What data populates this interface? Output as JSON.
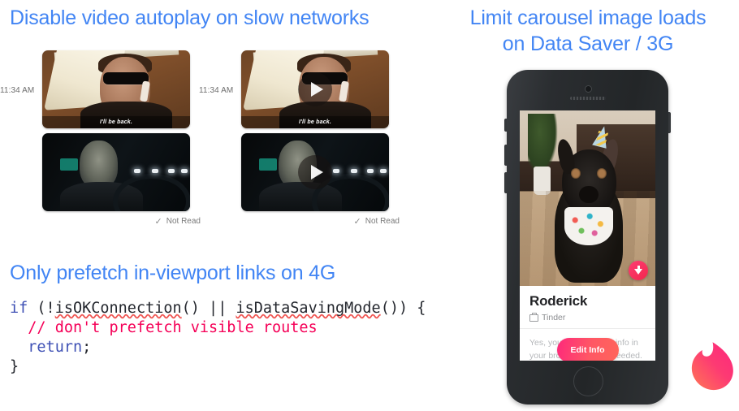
{
  "theme": {
    "heading_color": "#4285f4",
    "comment_color": "#f50057",
    "keyword_color": "#3f51b5",
    "tinder_pink": "#fd297b",
    "tinder_orange": "#ff655b"
  },
  "sections": {
    "video_autoplay": {
      "title": "Disable video autoplay on slow networks",
      "chat_before": {
        "timestamp": "11:34 AM",
        "caption": "I'll be back.",
        "status": "Not Read",
        "status_icon": "check-icon",
        "has_play_overlay": false
      },
      "chat_after": {
        "timestamp": "11:34 AM",
        "caption": "I'll be back.",
        "status": "Not Read",
        "status_icon": "check-icon",
        "has_play_overlay": true,
        "play_icon": "play-icon"
      }
    },
    "carousel": {
      "title": "Limit carousel image loads\non Data Saver / 3G",
      "phone": {
        "card": {
          "name": "Roderick",
          "source_icon": "briefcase-icon",
          "source": "Tinder",
          "body_text": "Yes, you can edit your info in your browser, no app needed.",
          "button_label": "Edit Info",
          "badge_icon": "download-icon"
        }
      },
      "logo": "tinder-flame-logo"
    },
    "prefetch": {
      "title": "Only prefetch in-viewport links on 4G",
      "code": {
        "line1_kw": "if",
        "line1_open": " (!",
        "line1_fn1": "isOKConnection",
        "line1_mid": "() || ",
        "line1_fn2": "isDataSavingMode",
        "line1_close": "()) {",
        "line2": "  // don't prefetch visible routes",
        "line3_kw": "  return",
        "line3_rest": ";",
        "line4": "}"
      }
    }
  }
}
